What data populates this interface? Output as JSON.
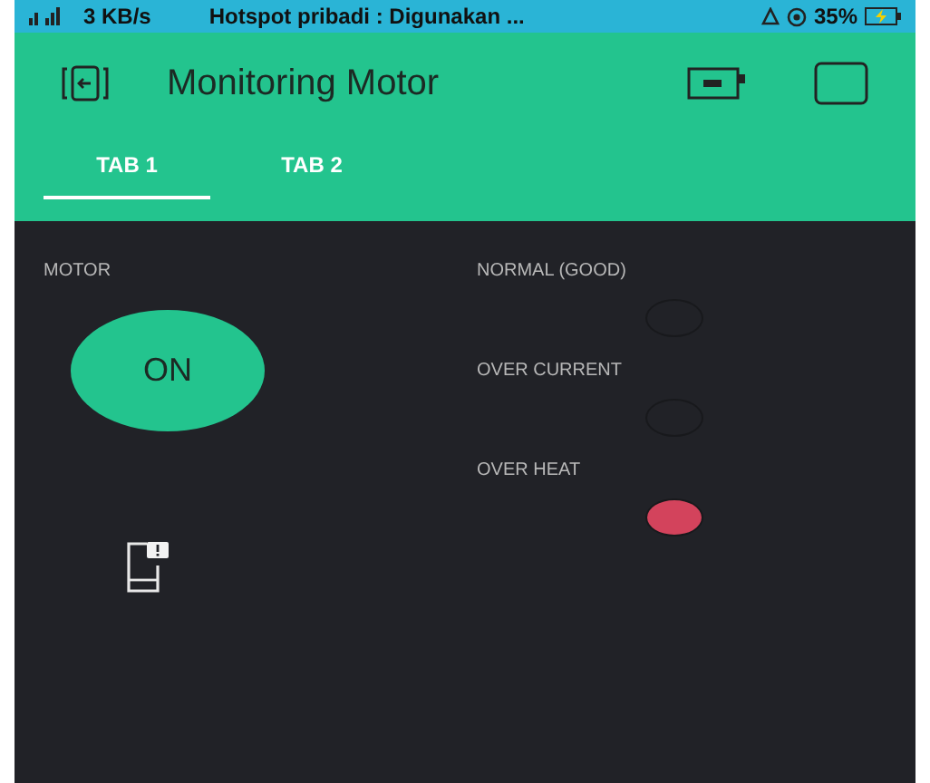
{
  "status_bar": {
    "speed": "3 KB/s",
    "notification": "Hotspot pribadi : Digunakan ...",
    "battery": "35%"
  },
  "app_bar": {
    "title": "Monitoring Motor"
  },
  "tabs": [
    {
      "label": "TAB 1",
      "selected": true
    },
    {
      "label": "TAB 2",
      "selected": false
    }
  ],
  "motor": {
    "label": "MOTOR",
    "button": "ON",
    "on": true
  },
  "leds": [
    {
      "label": "NORMAL (GOOD)",
      "on": false
    },
    {
      "label": "OVER CURRENT",
      "on": false
    },
    {
      "label": "OVER HEAT",
      "on": true,
      "color": "#d3435c"
    }
  ]
}
